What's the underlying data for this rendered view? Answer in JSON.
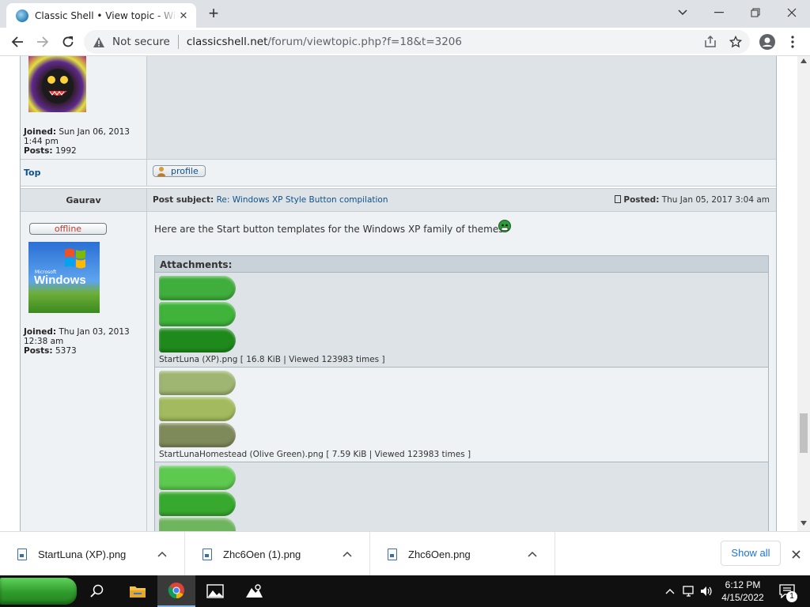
{
  "browser": {
    "tab_title": "Classic Shell • View topic - Windows XP Style Button compilation",
    "new_tab": "+",
    "security": "Not secure",
    "url_domain": "classicshell.net",
    "url_path": "/forum/viewtopic.php?f=18&t=3206"
  },
  "prev_post": {
    "joined_label": "Joined:",
    "joined": "Sun Jan 06, 2013 1:44 pm",
    "posts_label": "Posts:",
    "posts": "1992",
    "top_link": "Top",
    "profile_button": "profile"
  },
  "post": {
    "author": "Gaurav",
    "subject_label": "Post subject:",
    "subject": "Re: Windows XP Style Button compilation",
    "posted_label": "Posted:",
    "posted": "Thu Jan 05, 2017 3:04 am",
    "status": "offline",
    "avatar_small_text": "Microsoft",
    "avatar_text": "Windows",
    "joined_label": "Joined:",
    "joined": "Thu Jan 03, 2013 12:38 am",
    "posts_label": "Posts:",
    "posts": "5373",
    "body": "Here are the Start button templates for the Windows XP family of themes",
    "attachments_label": "Attachments:",
    "attachments": [
      {
        "caption": "StartLuna (XP).png [ 16.8 KiB | Viewed 123983 times ]",
        "colors": [
          "#3fae3c",
          "#3fb33a",
          "#1f8a1c"
        ]
      },
      {
        "caption": "StartLunaHomestead (Olive Green).png [ 7.59 KiB | Viewed 123983 times ]",
        "colors": [
          "#9fb572",
          "#a3bb5e",
          "#7f8a5a"
        ]
      },
      {
        "caption": "",
        "colors": [
          "#5dc94f",
          "#37a92e",
          "#6fb55e"
        ]
      }
    ]
  },
  "downloads": {
    "items": [
      "StartLuna (XP).png",
      "Zhc6Oen (1).png",
      "Zhc6Oen.png"
    ],
    "show_all": "Show all"
  },
  "taskbar": {
    "time": "6:12 PM",
    "date": "4/15/2022",
    "notification_count": "1"
  }
}
